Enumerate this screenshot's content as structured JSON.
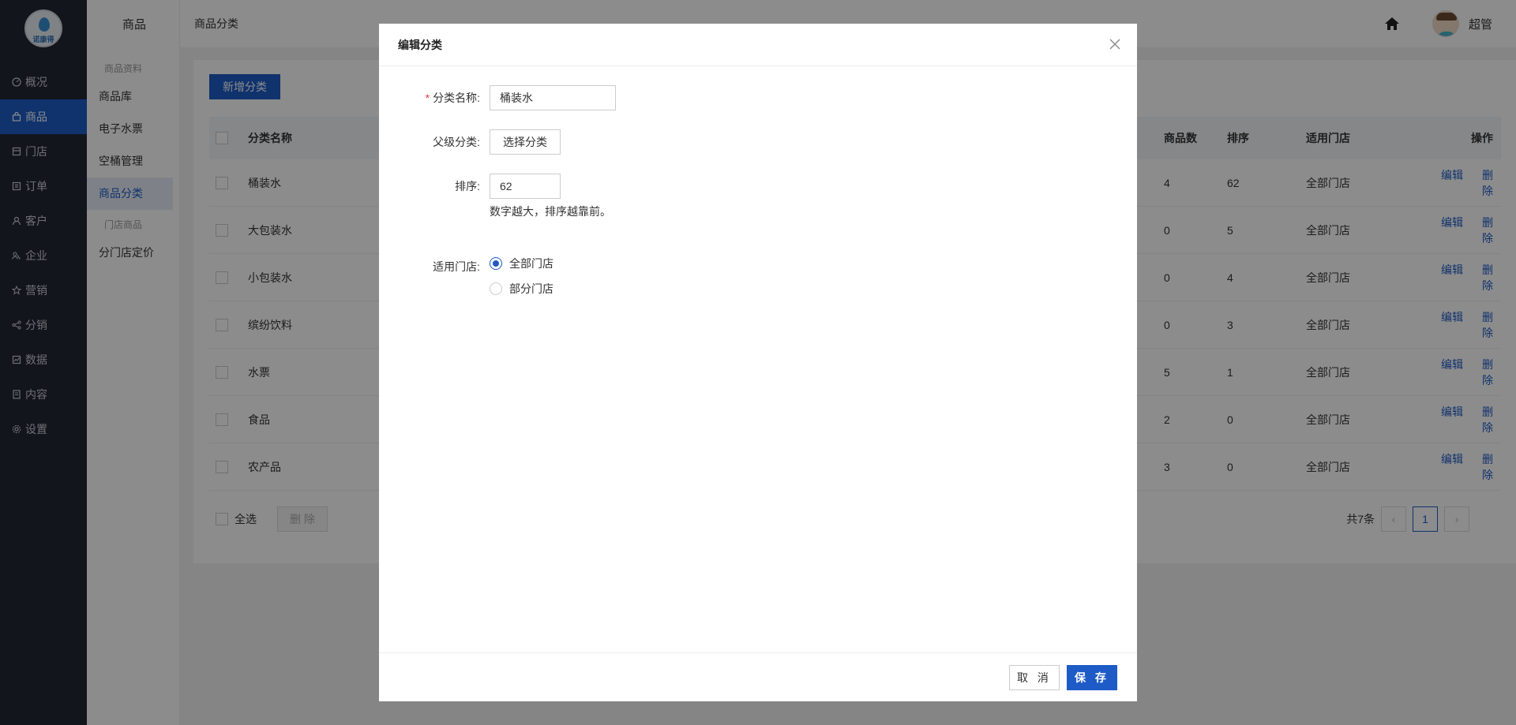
{
  "sidebar": {
    "logo_text": "诺康得",
    "items": [
      {
        "label": "概况",
        "icon": "dashboard-icon"
      },
      {
        "label": "商品",
        "icon": "shopping-bag-icon",
        "active": true
      },
      {
        "label": "门店",
        "icon": "store-icon"
      },
      {
        "label": "订单",
        "icon": "order-icon"
      },
      {
        "label": "客户",
        "icon": "user-icon"
      },
      {
        "label": "企业",
        "icon": "team-icon"
      },
      {
        "label": "营销",
        "icon": "star-icon"
      },
      {
        "label": "分销",
        "icon": "share-icon"
      },
      {
        "label": "数据",
        "icon": "chart-icon"
      },
      {
        "label": "内容",
        "icon": "document-icon"
      },
      {
        "label": "设置",
        "icon": "gear-icon"
      }
    ]
  },
  "subnav": {
    "title": "商品",
    "group1": "商品资料",
    "items1": [
      "商品库",
      "电子水票",
      "空桶管理",
      "商品分类"
    ],
    "group2": "门店商品",
    "items2": [
      "分门店定价"
    ]
  },
  "topbar": {
    "breadcrumb": "商品分类",
    "user_name": "超管"
  },
  "main": {
    "add_button": "新增分类",
    "headers": {
      "name": "分类名称",
      "count": "商品数",
      "sort": "排序",
      "store": "适用门店",
      "ops": "操作"
    },
    "rows": [
      {
        "name": "桶装水",
        "count": "4",
        "sort": "62",
        "store": "全部门店"
      },
      {
        "name": "大包装水",
        "count": "0",
        "sort": "5",
        "store": "全部门店"
      },
      {
        "name": "小包装水",
        "count": "0",
        "sort": "4",
        "store": "全部门店"
      },
      {
        "name": "缤纷饮料",
        "count": "0",
        "sort": "3",
        "store": "全部门店"
      },
      {
        "name": "水票",
        "count": "5",
        "sort": "1",
        "store": "全部门店"
      },
      {
        "name": "食品",
        "count": "2",
        "sort": "0",
        "store": "全部门店"
      },
      {
        "name": "农产品",
        "count": "3",
        "sort": "0",
        "store": "全部门店"
      }
    ],
    "edit_label": "编辑",
    "delete_label": "删除",
    "select_all": "全选",
    "bulk_delete": "删 除",
    "total": "共7条",
    "page": "1"
  },
  "modal": {
    "title": "编辑分类",
    "name_label": "分类名称:",
    "name_value": "桶装水",
    "parent_label": "父级分类:",
    "parent_button": "选择分类",
    "sort_label": "排序:",
    "sort_value": "62",
    "sort_hint": "数字越大，排序越靠前。",
    "store_label": "适用门店:",
    "store_options": [
      "全部门店",
      "部分门店"
    ],
    "cancel": "取 消",
    "save": "保 存"
  },
  "colors": {
    "primary": "#1e5bc6",
    "sidebar": "#222733",
    "required": "#e4393c"
  }
}
